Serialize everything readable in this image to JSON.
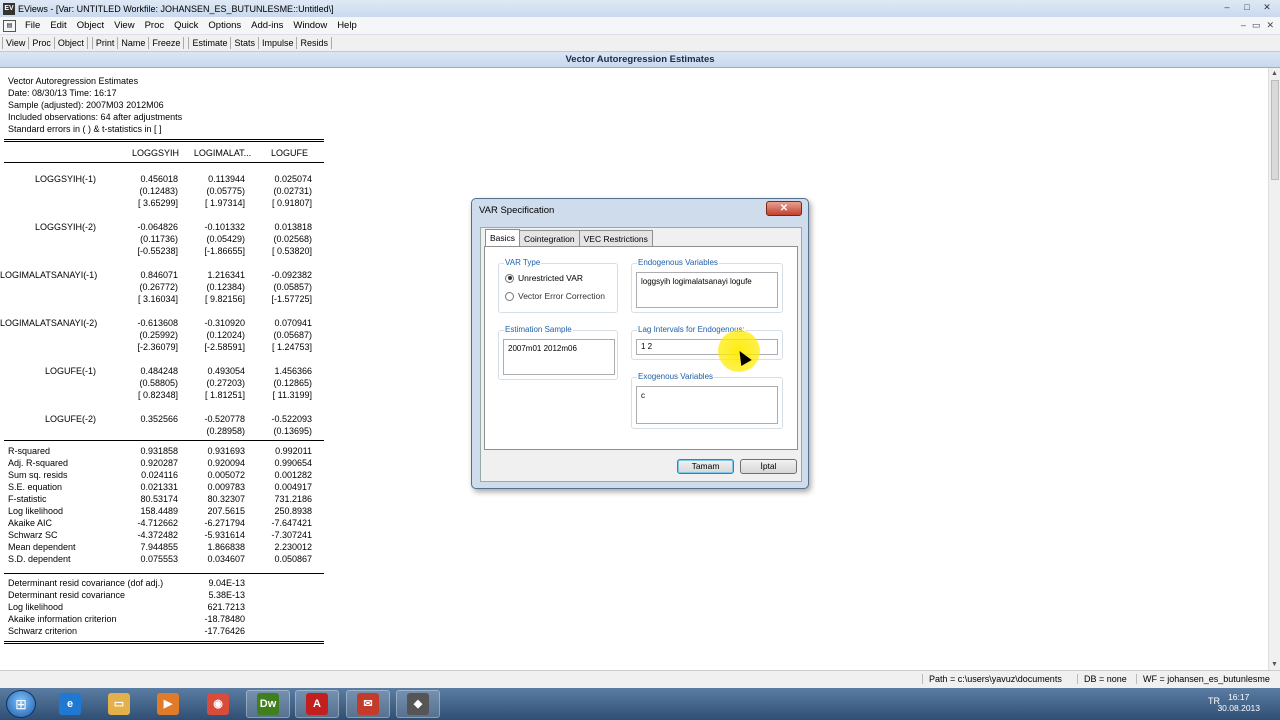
{
  "window": {
    "app_icon": "EV",
    "title": "EViews - [Var: UNTITLED   Workfile: JOHANSEN_ES_BUTUNLESME::Untitled\\]",
    "controls": [
      "–",
      "□",
      "✕"
    ]
  },
  "menu": {
    "items": [
      "File",
      "Edit",
      "Object",
      "View",
      "Proc",
      "Quick",
      "Options",
      "Add-ins",
      "Window",
      "Help"
    ],
    "mdi_controls": [
      "–",
      "▭",
      "✕"
    ]
  },
  "toolbar": {
    "buttons": [
      "View",
      "Proc",
      "Object",
      "Print",
      "Name",
      "Freeze",
      "Estimate",
      "Stats",
      "Impulse",
      "Resids"
    ]
  },
  "header_title": "Vector Autoregression Estimates",
  "output": {
    "info": [
      "Vector Autoregression Estimates",
      "Date: 08/30/13   Time: 16:17",
      "Sample (adjusted): 2007M03 2012M06",
      "Included observations: 64 after adjustments",
      "Standard errors in ( ) & t-statistics in [ ]"
    ],
    "columns": [
      "LOGGSYIH",
      "LOGIMALAT...",
      "LOGUFE"
    ],
    "coefficients": [
      {
        "label": "LOGGSYIH(-1)",
        "rows": [
          [
            "0.456018",
            "0.113944",
            "0.025074"
          ],
          [
            "(0.12483)",
            "(0.05775)",
            "(0.02731)"
          ],
          [
            "[ 3.65299]",
            "[ 1.97314]",
            "[ 0.91807]"
          ]
        ]
      },
      {
        "label": "LOGGSYIH(-2)",
        "rows": [
          [
            "-0.064826",
            "-0.101332",
            "0.013818"
          ],
          [
            "(0.11736)",
            "(0.05429)",
            "(0.02568)"
          ],
          [
            "[-0.55238]",
            "[-1.86655]",
            "[ 0.53820]"
          ]
        ]
      },
      {
        "label": "LOGIMALATSANAYI(-1)",
        "rows": [
          [
            "0.846071",
            "1.216341",
            "-0.092382"
          ],
          [
            "(0.26772)",
            "(0.12384)",
            "(0.05857)"
          ],
          [
            "[ 3.16034]",
            "[ 9.82156]",
            "[-1.57725]"
          ]
        ]
      },
      {
        "label": "LOGIMALATSANAYI(-2)",
        "rows": [
          [
            "-0.613608",
            "-0.310920",
            "0.070941"
          ],
          [
            "(0.25992)",
            "(0.12024)",
            "(0.05687)"
          ],
          [
            "[-2.36079]",
            "[-2.58591]",
            "[ 1.24753]"
          ]
        ]
      },
      {
        "label": "LOGUFE(-1)",
        "rows": [
          [
            "0.484248",
            "0.493054",
            "1.456366"
          ],
          [
            "(0.58805)",
            "(0.27203)",
            "(0.12865)"
          ],
          [
            "[ 0.82348]",
            "[ 1.81251]",
            "[ 11.3199]"
          ]
        ]
      },
      {
        "label": "LOGUFE(-2)",
        "rows": [
          [
            "0.352566",
            "-0.520778",
            "-0.522093"
          ],
          [
            "",
            "(0.28958)",
            "(0.13695)"
          ],
          [
            "",
            "",
            ""
          ]
        ]
      }
    ],
    "stats": [
      {
        "label": "R-squared",
        "values": [
          "0.931858",
          "0.931693",
          "0.992011"
        ]
      },
      {
        "label": "Adj. R-squared",
        "values": [
          "0.920287",
          "0.920094",
          "0.990654"
        ]
      },
      {
        "label": "Sum sq. resids",
        "values": [
          "0.024116",
          "0.005072",
          "0.001282"
        ]
      },
      {
        "label": "S.E. equation",
        "values": [
          "0.021331",
          "0.009783",
          "0.004917"
        ]
      },
      {
        "label": "F-statistic",
        "values": [
          "80.53174",
          "80.32307",
          "731.2186"
        ]
      },
      {
        "label": "Log likelihood",
        "values": [
          "158.4489",
          "207.5615",
          "250.8938"
        ]
      },
      {
        "label": "Akaike AIC",
        "values": [
          "-4.712662",
          "-6.271794",
          "-7.647421"
        ]
      },
      {
        "label": "Schwarz SC",
        "values": [
          "-4.372482",
          "-5.931614",
          "-7.307241"
        ]
      },
      {
        "label": "Mean dependent",
        "values": [
          "7.944855",
          "1.866838",
          "2.230012"
        ]
      },
      {
        "label": "S.D. dependent",
        "values": [
          "0.075553",
          "0.034607",
          "0.050867"
        ]
      }
    ],
    "det_stats": [
      {
        "label": "Determinant resid covariance (dof adj.)",
        "value": "9.04E-13"
      },
      {
        "label": "Determinant resid covariance",
        "value": "5.38E-13"
      },
      {
        "label": "Log likelihood",
        "value": "621.7213"
      },
      {
        "label": "Akaike information criterion",
        "value": "-18.78480"
      },
      {
        "label": "Schwarz criterion",
        "value": "-17.76426"
      }
    ]
  },
  "statusbar": {
    "path": "Path = c:\\users\\yavuz\\documents",
    "db": "DB = none",
    "wf": "WF = johansen_es_butunlesme"
  },
  "dialog": {
    "title": "VAR Specification",
    "close": "✕",
    "tabs": [
      "Basics",
      "Cointegration",
      "VEC Restrictions"
    ],
    "var_type": {
      "label": "VAR Type",
      "options": [
        "Unrestricted VAR",
        "Vector Error Correction"
      ],
      "selected": "Unrestricted VAR"
    },
    "endogenous": {
      "label": "Endogenous Variables",
      "value": "loggsyih logimalatsanayi logufe"
    },
    "estimation_sample": {
      "label": "Estimation Sample",
      "value": "2007m01 2012m06"
    },
    "lag_intervals": {
      "label": "Lag Intervals for Endogenous:",
      "value": "1 2"
    },
    "exogenous": {
      "label": "Exogenous Variables",
      "value": "c"
    },
    "ok": "Tamam",
    "cancel": "İptal"
  },
  "taskbar": {
    "start": "⊞",
    "apps": [
      {
        "icon": "e",
        "color": "#1f78d1"
      },
      {
        "icon": "▭",
        "color": "#e3b04b"
      },
      {
        "icon": "▶",
        "color": "#e07b2a"
      },
      {
        "icon": "◉",
        "color": "#d94b3b"
      },
      {
        "icon": "Dw",
        "color": "#3f7f1d"
      },
      {
        "icon": "A",
        "color": "#c21f1f"
      },
      {
        "icon": "✉",
        "color": "#c23b2b"
      },
      {
        "icon": "◆",
        "color": "#555555"
      }
    ],
    "tray_lang": "TR",
    "clock_time": "16:17",
    "clock_date": "30.08.2013"
  }
}
